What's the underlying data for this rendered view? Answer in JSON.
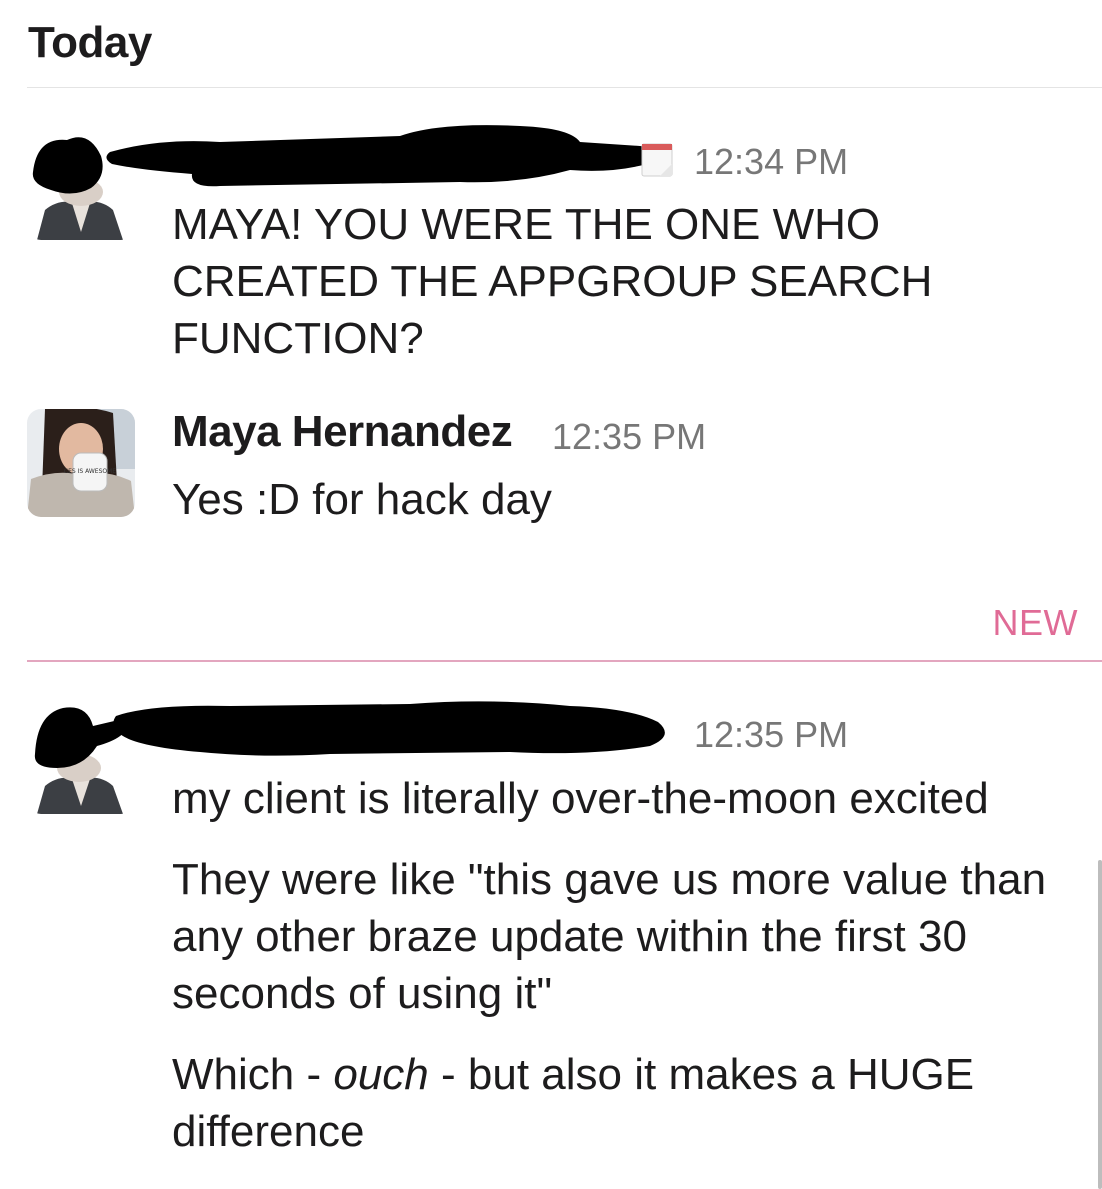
{
  "header": {
    "day": "Today"
  },
  "new_marker": "NEW",
  "messages": [
    {
      "sender": "",
      "time": "12:34 PM",
      "paragraphs": [
        "MAYA! YOU WERE THE ONE WHO CREATED THE APPGROUP SEARCH FUNCTION?"
      ]
    },
    {
      "sender": "Maya Hernandez",
      "time": "12:35 PM",
      "paragraphs": [
        "Yes :D for hack day"
      ],
      "mug_text": "CES IS AWESOME"
    },
    {
      "sender": "",
      "time": "12:35 PM",
      "paragraphs": [
        "my client is literally over-the-moon excited",
        "They were like \"this gave us more value than any other braze update within the first 30 seconds of using it\""
      ],
      "last_paragraph": {
        "before": "Which - ",
        "emphasis": "ouch",
        "after": " - but also it makes a HUGE difference"
      }
    }
  ]
}
